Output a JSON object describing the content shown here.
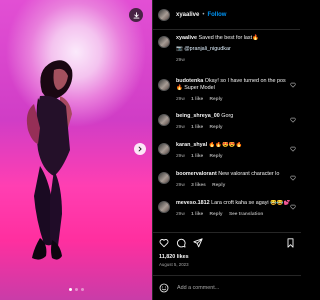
{
  "header": {
    "username": "xyaalive",
    "separator": "•",
    "follow_label": "Follow"
  },
  "caption": {
    "username": "xyaalive",
    "text": "Saved the best for last🔥",
    "mention": "📷 @pranjali_nigudkar",
    "time": "29w"
  },
  "comments": [
    {
      "username": "budotenka",
      "text": "Okay! so I have turned on the pos",
      "text2": "🔥 Super Model",
      "time": "29w",
      "likes": "1 like",
      "reply": "Reply"
    },
    {
      "username": "being_shreya_00",
      "text": "Gorg",
      "time": "29w",
      "likes": "1 like",
      "reply": "Reply"
    },
    {
      "username": "karan_shyal",
      "text": "🔥🔥😍😍🔥",
      "time": "29w",
      "likes": "1 like",
      "reply": "Reply"
    },
    {
      "username": "boomervalorant",
      "text": "New valorant character lo",
      "time": "29w",
      "likes": "3 likes",
      "reply": "Reply"
    },
    {
      "username": "meveso.1812",
      "text": "Lara croft kaha se agayi 😂😂💕",
      "time": "29w",
      "likes": "1 like",
      "reply": "Reply",
      "translate": "See translation"
    }
  ],
  "stats": {
    "likes": "11,820 likes",
    "date": "August 5, 2023"
  },
  "add_comment": {
    "placeholder": "Add a comment..."
  },
  "icons": {
    "download": "download-icon",
    "next": "chevron-right-icon",
    "heart": "heart-icon",
    "comment": "comment-icon",
    "share": "share-icon",
    "save": "bookmark-icon",
    "emoji": "emoji-icon"
  },
  "carousel": {
    "count": 3,
    "active": 1
  }
}
